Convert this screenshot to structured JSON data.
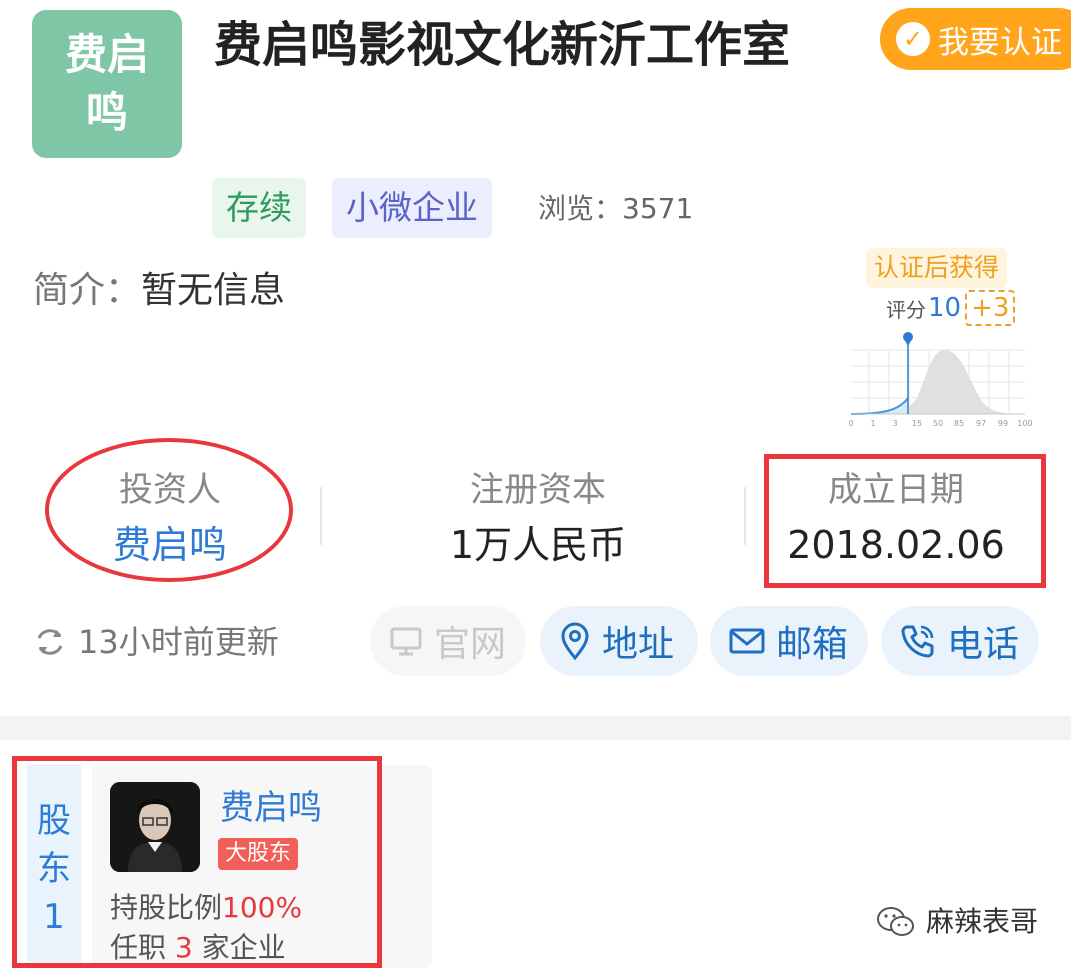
{
  "company": {
    "logo_text": "费启鸣",
    "name": "费启鸣影视文化新沂工作室",
    "verify_button": "我要认证",
    "tags": {
      "status": "存续",
      "scale": "小微企业"
    },
    "views": "浏览：3571",
    "intro_label": "简介：",
    "intro_value": "暂无信息"
  },
  "score": {
    "cert_tip": "认证后获得",
    "label": "评分",
    "value": "10",
    "bonus": "+3",
    "axis_ticks": [
      "0",
      "1",
      "3",
      "15",
      "50",
      "85",
      "97",
      "99",
      "100"
    ]
  },
  "stats": {
    "investor_label": "投资人",
    "investor_value": "费启鸣",
    "capital_label": "注册资本",
    "capital_value": "1万人民币",
    "date_label": "成立日期",
    "date_value": "2018.02.06"
  },
  "update_text": "13小时前更新",
  "contacts": {
    "website": "官网",
    "address": "地址",
    "email": "邮箱",
    "phone": "电话"
  },
  "shareholders": {
    "side_label_1": "股",
    "side_label_2": "东",
    "side_count": "1",
    "name": "费启鸣",
    "badge": "大股东",
    "ratio_label": "持股比例",
    "ratio_value": "100%",
    "jobs_prefix": "任职",
    "jobs_count": "3",
    "jobs_suffix": "家企业"
  },
  "watermark": "麻辣表哥",
  "colors": {
    "link_blue": "#2e7bd6",
    "logo_green": "#7fc6a6",
    "verify_orange": "#ffa41b",
    "highlight_red": "#e8383d"
  }
}
